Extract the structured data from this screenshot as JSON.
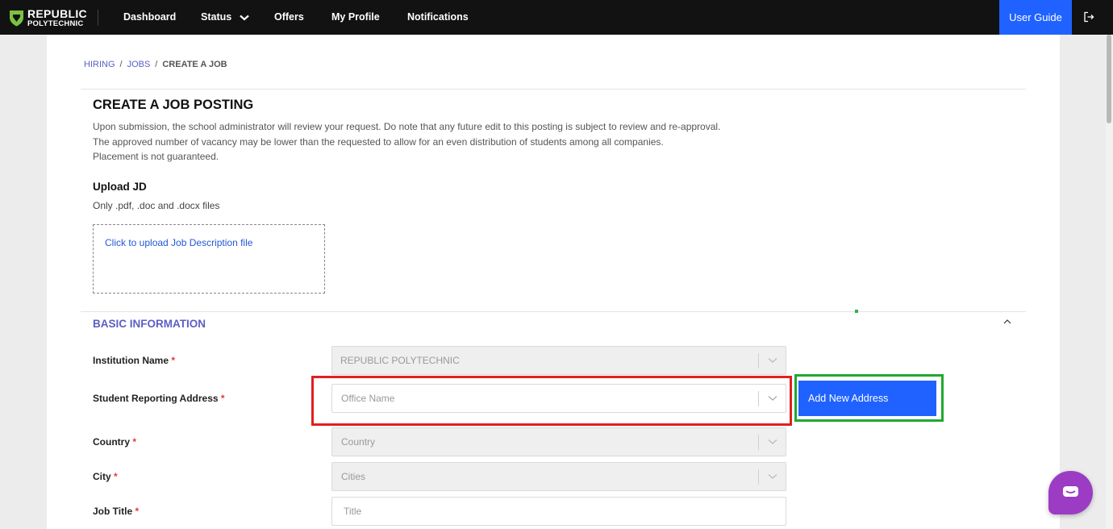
{
  "nav": {
    "logo_line1": "REPUBLIC",
    "logo_line2": "POLYTECHNIC",
    "items": [
      {
        "label": "Dashboard"
      },
      {
        "label": "Status"
      },
      {
        "label": "Offers"
      },
      {
        "label": "My Profile"
      },
      {
        "label": "Notifications"
      }
    ],
    "user_guide": "User Guide"
  },
  "breadcrumb": {
    "items": [
      "HIRING",
      "JOBS",
      "CREATE A JOB"
    ],
    "separator": "/"
  },
  "page": {
    "title": "CREATE A JOB POSTING",
    "description": [
      "Upon submission, the school administrator will review your request. Do note that any future edit to this posting is subject to review and re-approval.",
      "The approved number of vacancy may be lower than the requested to allow for an even distribution of students among all companies.",
      "Placement is not guaranteed."
    ]
  },
  "upload": {
    "title": "Upload JD",
    "note": "Only .pdf, .doc and .docx files",
    "dropzone_text": "Click to upload Job Description file"
  },
  "basic_info": {
    "title": "BASIC INFORMATION",
    "required_marker": "*",
    "fields": {
      "institution": {
        "label": "Institution Name",
        "value": "REPUBLIC POLYTECHNIC"
      },
      "address": {
        "label": "Student Reporting Address",
        "placeholder": "Office Name"
      },
      "country": {
        "label": "Country",
        "placeholder": "Country"
      },
      "city": {
        "label": "City",
        "placeholder": "Cities"
      },
      "job_title": {
        "label": "Job Title",
        "placeholder": "Title"
      }
    },
    "add_address_button": "Add New Address"
  },
  "colors": {
    "brand_blue": "#1f62ff",
    "section_purple": "#5b5fc4",
    "required_red": "#e53935",
    "highlight_red": "#e02020",
    "highlight_green": "#20a830",
    "chat_purple": "#9c3cc4"
  },
  "icons": [
    "shield-logo-icon",
    "chevron-down-icon",
    "logout-icon",
    "chevron-up-icon",
    "chat-icon"
  ]
}
